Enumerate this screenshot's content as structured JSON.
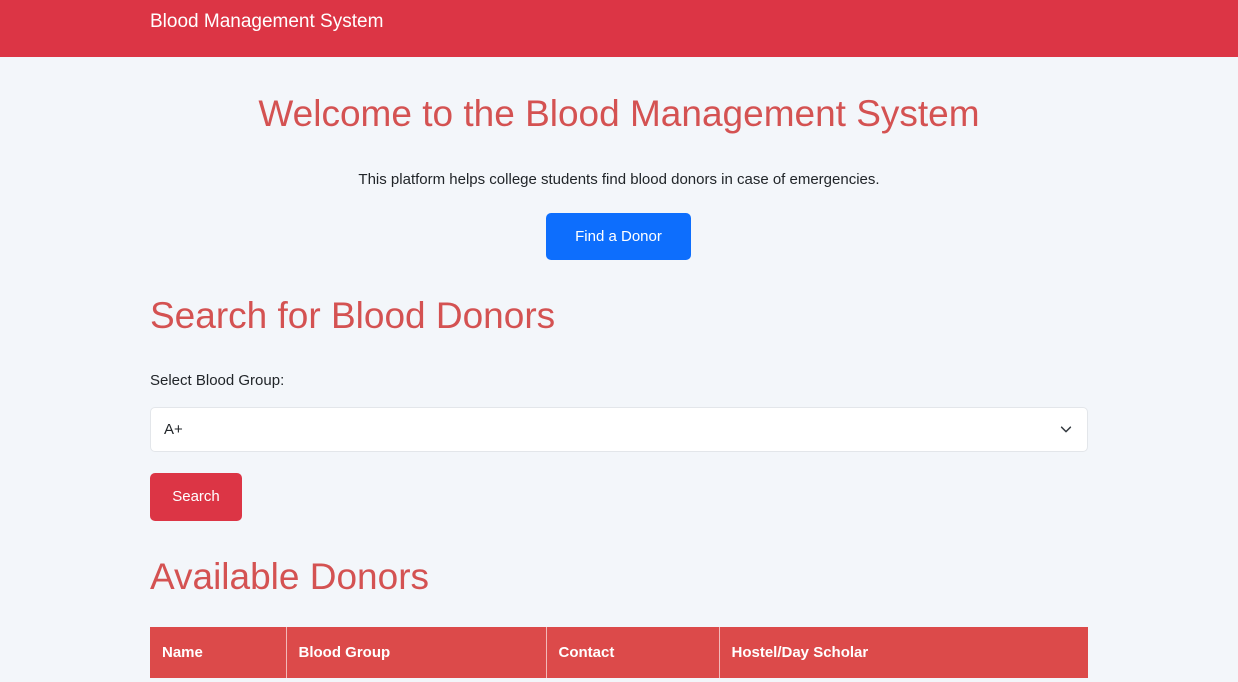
{
  "navbar": {
    "brand": "Blood Management System"
  },
  "hero": {
    "title": "Welcome to the Blood Management System",
    "description": "This platform helps college students find blood donors in case of emergencies.",
    "find_button": "Find a Donor"
  },
  "search": {
    "title": "Search for Blood Donors",
    "select_label": "Select Blood Group:",
    "selected_value": "A+",
    "search_button": "Search"
  },
  "donors": {
    "title": "Available Donors",
    "columns": [
      "Name",
      "Blood Group",
      "Contact",
      "Hostel/Day Scholar"
    ]
  },
  "colors": {
    "primary_red": "#dc3545",
    "heading_red": "#d45252",
    "primary_blue": "#0d6efd"
  },
  "icons": {
    "select_chevron": "chevron-down-icon"
  }
}
